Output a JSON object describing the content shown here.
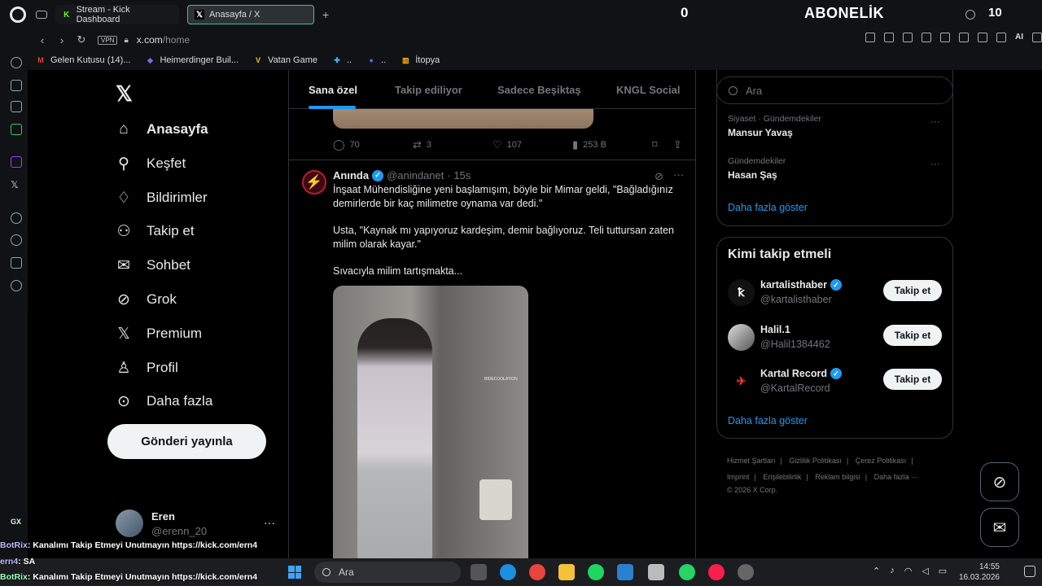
{
  "browser": {
    "tabs": [
      {
        "label": "Stream - Kick Dashboard",
        "icon": "kick-icon"
      },
      {
        "label": "Anasayfa / X",
        "icon": "x-icon"
      }
    ],
    "url_host": "x.com",
    "url_path": "/home",
    "vpn_label": "VPN",
    "ai_label": "AI",
    "bookmarks": [
      "Gelen Kutusu (14)...",
      "Heimerdinger Buil...",
      "Vatan Game",
      "..",
      "..",
      "İtopya"
    ],
    "bookmark_icons": [
      "gmail-icon",
      "heimerdinger-icon",
      "vatan-icon",
      "plus-icon",
      "discord-icon",
      "itopya-icon"
    ]
  },
  "stream_overlay": {
    "viewer_count": "0",
    "title": "ABONELİK",
    "sub_count": "10"
  },
  "sidenav": {
    "items": [
      {
        "label": "Anasayfa",
        "icon": "home-icon"
      },
      {
        "label": "Keşfet",
        "icon": "search-icon"
      },
      {
        "label": "Bildirimler",
        "icon": "bell-icon"
      },
      {
        "label": "Takip et",
        "icon": "add-user-icon"
      },
      {
        "label": "Sohbet",
        "icon": "mail-icon"
      },
      {
        "label": "Grok",
        "icon": "grok-icon"
      },
      {
        "label": "Premium",
        "icon": "x-icon"
      },
      {
        "label": "Profil",
        "icon": "person-icon"
      },
      {
        "label": "Daha fazla",
        "icon": "more-circle-icon"
      }
    ],
    "post_button": "Gönderi yayınla",
    "account": {
      "name": "Eren",
      "handle": "@erenn_20"
    }
  },
  "feed": {
    "tabs": [
      "Sana özel",
      "Takip ediliyor",
      "Sadece Beşiktaş",
      "KNGL Social"
    ],
    "prev_actions": {
      "replies": "70",
      "reposts": "3",
      "likes": "107",
      "views": "253 B"
    },
    "tweet": {
      "name": "Anında",
      "handle": "@anindanet",
      "time": "· 15s",
      "p1": "İnşaat Mühendisliğine yeni başlamışım, böyle bir Mimar geldi, \"Bağladığınız demirlerde bir kaç milimetre oynama var dedi.\"",
      "p2": "Usta, \"Kaynak mı yapıyoruz kardeşim, demir bağlıyoruz. Teli tuttursan zaten milim olarak kayar.\"",
      "p3": " Sıvacıyla milim tartışmakta...",
      "media_watermark": "BIDECOOLATION"
    }
  },
  "right": {
    "search_placeholder": "Ara",
    "trends": [
      {
        "category": "Siyaset · Gündemdekiler",
        "name": "Mansur Yavaş"
      },
      {
        "category": "Gündemdekiler",
        "name": "Hasan Şaş"
      }
    ],
    "show_more": "Daha fazla göster",
    "who_to_follow_title": "Kimi takip etmeli",
    "who_to_follow": [
      {
        "name": "kartalisthaber",
        "handle": "@kartalisthaber",
        "verified": true
      },
      {
        "name": "Halil.1",
        "handle": "@Halil1384462",
        "verified": false
      },
      {
        "name": "Kartal Record",
        "handle": "@KartalRecord",
        "verified": true
      }
    ],
    "follow_label": "Takip et",
    "show_more2": "Daha fazla göster",
    "footer": [
      "Hizmet Şartları",
      "|",
      "Gizlilik Politikası",
      "|",
      "Çerez Politikası",
      "|",
      "Imprint",
      "|",
      "Erişilebilirlik",
      "|",
      "Reklam bilgisi",
      "|",
      "Daha fazla ···",
      "© 2026 X Corp."
    ]
  },
  "chat": [
    {
      "user": "BotRix",
      "text": ": Kanalımı Takip Etmeyi Unutmayın https://kick.com/ern4"
    },
    {
      "user": "ern4",
      "text": ": SA"
    },
    {
      "user": "BotRix",
      "text": ": Kanalımı Takip Etmeyi Unutmayın https://kick.com/ern4"
    }
  ],
  "taskbar": {
    "search": "Ara",
    "time": "14:55",
    "date": "16.03.2026"
  }
}
